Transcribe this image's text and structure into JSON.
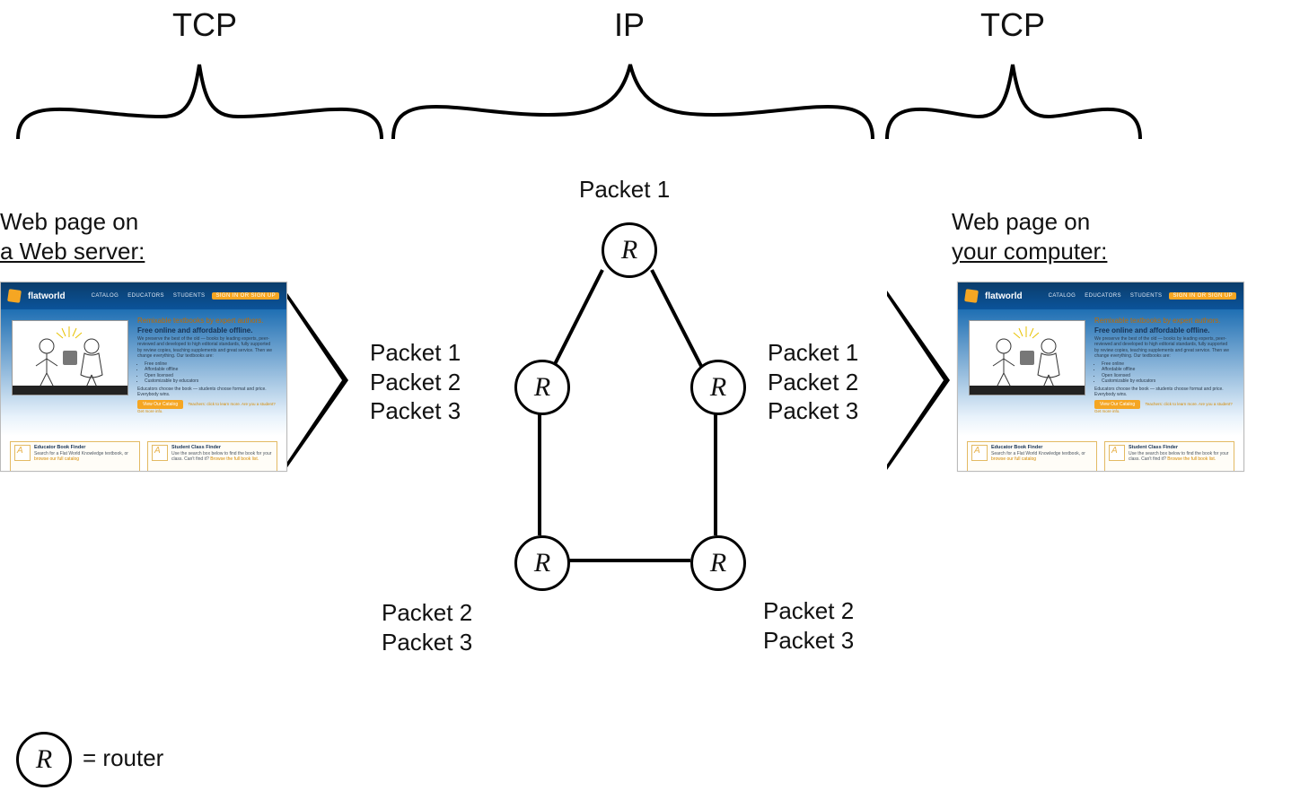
{
  "headers": {
    "tcp_left": "TCP",
    "ip": "IP",
    "tcp_right": "TCP"
  },
  "captions": {
    "server_l1": "Web page on",
    "server_l2": "a Web server:",
    "client_l1": "Web page on",
    "client_l2": "your computer:"
  },
  "packets": {
    "top": "Packet 1",
    "left_list": "Packet 1\nPacket 2\nPacket 3",
    "right_list": "Packet 1\nPacket 2\nPacket 3",
    "bottom_left": "Packet 2\nPacket 3",
    "bottom_right": "Packet 2\nPacket 3"
  },
  "router_glyph": "R",
  "legend": "= router",
  "webpage": {
    "brand": "flatworld",
    "nav": [
      "CATALOG",
      "EDUCATORS",
      "STUDENTS"
    ],
    "signin": "SIGN IN OR SIGN UP",
    "headline1": "Remixable textbooks by expert authors.",
    "headline2": "Free online and affordable offline.",
    "blurb": "We preserve the best of the old — books by leading experts, peer-reviewed and developed to high editorial standards, fully supported by review copies, teaching supplements and great service. Then we change everything. Our textbooks are:",
    "bullets": [
      "Free online",
      "Affordable offline",
      "Open licensed",
      "Customizable by educators"
    ],
    "sub": "Educators choose the book — students choose format and price. Everybody wins.",
    "cta": "View Our Catalog",
    "links": "Teachers: click to learn more.\nAre you a student? Get more info.",
    "card1_title": "Educator Book Finder",
    "card1_body": "Search for a Flat World Knowledge textbook, or ",
    "card1_link": "browse our full catalog",
    "card2_title": "Student Class Finder",
    "card2_body": "Use the search box below to find the book for your class. Can't find it? ",
    "card2_link": "Browse the full book list."
  }
}
